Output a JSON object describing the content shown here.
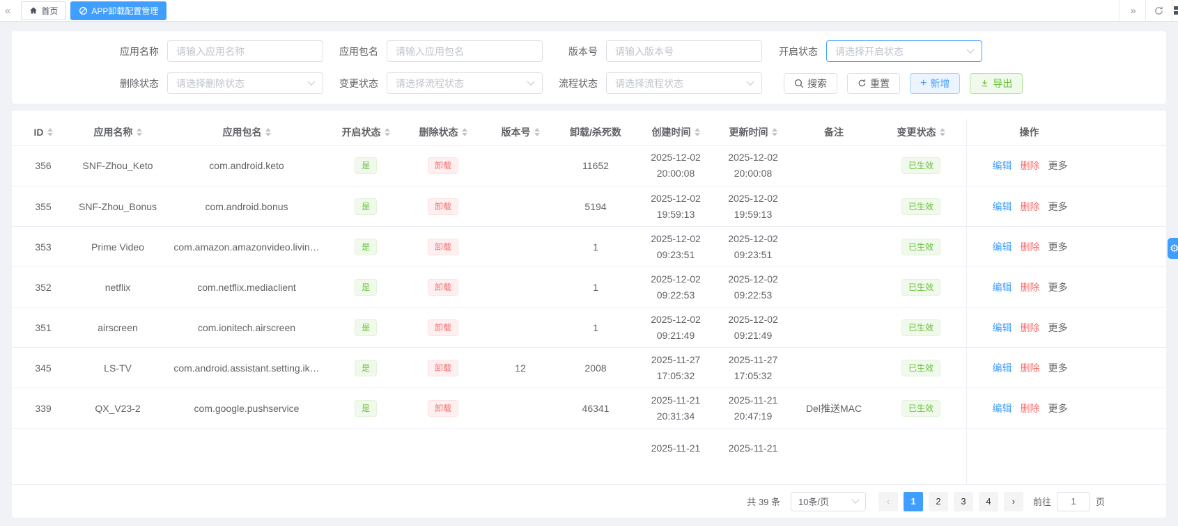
{
  "colors": {
    "accent": "#409eff",
    "success": "#67c23a",
    "danger": "#f56c6c"
  },
  "topbar": {
    "back_icon": "«",
    "forward_icon": "»",
    "tabs": [
      {
        "label": "首页",
        "icon": "home-icon",
        "active": false
      },
      {
        "label": "APP卸载配置管理",
        "icon": "ban-icon",
        "active": true
      }
    ]
  },
  "filters": {
    "fields": [
      {
        "label": "应用名称",
        "type": "input",
        "placeholder": "请输入应用名称"
      },
      {
        "label": "应用包名",
        "type": "input",
        "placeholder": "请输入应用包名"
      },
      {
        "label": "版本号",
        "type": "input",
        "placeholder": "请输入版本号"
      },
      {
        "label": "开启状态",
        "type": "select",
        "placeholder": "请选择开启状态",
        "focused": true
      },
      {
        "label": "删除状态",
        "type": "select",
        "placeholder": "请选择删除状态"
      },
      {
        "label": "变更状态",
        "type": "select",
        "placeholder": "请选择流程状态"
      },
      {
        "label": "流程状态",
        "type": "select",
        "placeholder": "请选择流程状态"
      }
    ],
    "buttons": [
      {
        "name": "search",
        "label": "搜索",
        "icon": "search-icon",
        "style": "default"
      },
      {
        "name": "reset",
        "label": "重置",
        "icon": "refresh-icon",
        "style": "default"
      },
      {
        "name": "add",
        "label": "新增",
        "icon": "plus-icon",
        "style": "primary-plain"
      },
      {
        "name": "export",
        "label": "导出",
        "icon": "download-icon",
        "style": "success-plain"
      }
    ]
  },
  "table": {
    "columns": [
      {
        "key": "id",
        "label": "ID",
        "sortable": true
      },
      {
        "key": "name",
        "label": "应用名称",
        "sortable": true
      },
      {
        "key": "pkg",
        "label": "应用包名",
        "sortable": true
      },
      {
        "key": "enable",
        "label": "开启状态",
        "sortable": true,
        "type": "tag-success"
      },
      {
        "key": "del",
        "label": "删除状态",
        "sortable": true,
        "type": "tag-danger"
      },
      {
        "key": "version",
        "label": "版本号",
        "sortable": true
      },
      {
        "key": "count",
        "label": "卸载/杀死数",
        "sortable": false
      },
      {
        "key": "created",
        "label": "创建时间",
        "sortable": true,
        "type": "datetime"
      },
      {
        "key": "updated",
        "label": "更新时间",
        "sortable": true,
        "type": "datetime"
      },
      {
        "key": "remark",
        "label": "备注",
        "sortable": false
      },
      {
        "key": "change",
        "label": "变更状态",
        "sortable": true,
        "type": "tag-success"
      },
      {
        "key": "actions",
        "label": "操作",
        "sortable": false,
        "type": "actions"
      }
    ],
    "action_labels": [
      {
        "name": "edit",
        "label": "编辑",
        "color": "primary"
      },
      {
        "name": "delete",
        "label": "删除",
        "color": "danger"
      },
      {
        "name": "more",
        "label": "更多",
        "color": "default"
      }
    ],
    "rows": [
      {
        "id": "356",
        "name": "SNF-Zhou_Keto",
        "pkg": "com.android.keto",
        "enable": "是",
        "del": "卸载",
        "version": "",
        "count": "11652",
        "created": [
          "2025-12-02",
          "20:00:08"
        ],
        "updated": [
          "2025-12-02",
          "20:00:08"
        ],
        "remark": "",
        "change": "已生效"
      },
      {
        "id": "355",
        "name": "SNF-Zhou_Bonus",
        "pkg": "com.android.bonus",
        "enable": "是",
        "del": "卸载",
        "version": "",
        "count": "5194",
        "created": [
          "2025-12-02",
          "19:59:13"
        ],
        "updated": [
          "2025-12-02",
          "19:59:13"
        ],
        "remark": "",
        "change": "已生效"
      },
      {
        "id": "353",
        "name": "Prime Video",
        "pkg": "com.amazon.amazonvideo.livin…",
        "enable": "是",
        "del": "卸载",
        "version": "",
        "count": "1",
        "created": [
          "2025-12-02",
          "09:23:51"
        ],
        "updated": [
          "2025-12-02",
          "09:23:51"
        ],
        "remark": "",
        "change": "已生效"
      },
      {
        "id": "352",
        "name": "netflix",
        "pkg": "com.netflix.mediaclient",
        "enable": "是",
        "del": "卸载",
        "version": "",
        "count": "1",
        "created": [
          "2025-12-02",
          "09:22:53"
        ],
        "updated": [
          "2025-12-02",
          "09:22:53"
        ],
        "remark": "",
        "change": "已生效"
      },
      {
        "id": "351",
        "name": "airscreen",
        "pkg": "com.ionitech.airscreen",
        "enable": "是",
        "del": "卸载",
        "version": "",
        "count": "1",
        "created": [
          "2025-12-02",
          "09:21:49"
        ],
        "updated": [
          "2025-12-02",
          "09:21:49"
        ],
        "remark": "",
        "change": "已生效"
      },
      {
        "id": "345",
        "name": "LS-TV",
        "pkg": "com.android.assistant.setting.ik…",
        "enable": "是",
        "del": "卸载",
        "version": "12",
        "count": "2008",
        "created": [
          "2025-11-27",
          "17:05:32"
        ],
        "updated": [
          "2025-11-27",
          "17:05:32"
        ],
        "remark": "",
        "change": "已生效"
      },
      {
        "id": "339",
        "name": "QX_V23-2",
        "pkg": "com.google.pushservice",
        "enable": "是",
        "del": "卸载",
        "version": "",
        "count": "46341",
        "created": [
          "2025-11-21",
          "20:31:34"
        ],
        "updated": [
          "2025-11-21",
          "20:47:19"
        ],
        "remark": "Del推送MAC",
        "change": "已生效"
      },
      {
        "id": "",
        "name": "",
        "pkg": "",
        "enable": "",
        "del": "",
        "version": "",
        "count": "",
        "created": [
          "2025-11-21",
          ""
        ],
        "updated": [
          "2025-11-21",
          ""
        ],
        "remark": "",
        "change": "",
        "partial": true
      }
    ]
  },
  "pagination": {
    "total": "共 39 条",
    "page_size": "10条/页",
    "prev_icon": "‹",
    "next_icon": "›",
    "pages": [
      "1",
      "2",
      "3",
      "4"
    ],
    "active_page": "1",
    "goto_label": "前往",
    "goto_value": "1",
    "goto_suffix": "页"
  }
}
